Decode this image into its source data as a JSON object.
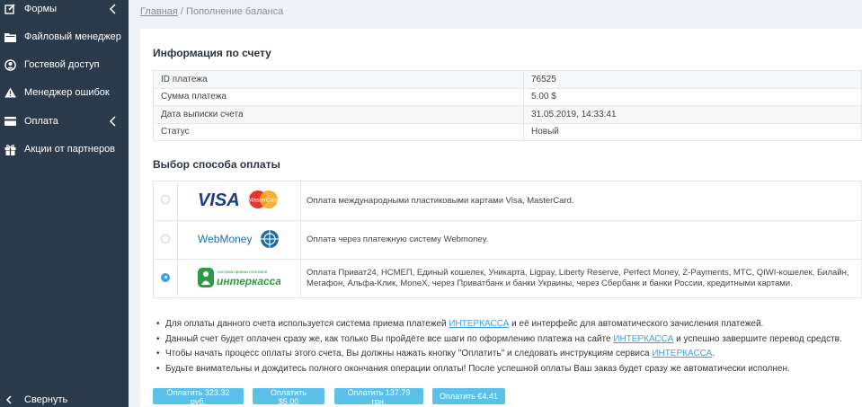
{
  "sidebar": {
    "items": [
      {
        "label": "Формы",
        "icon": "edit-icon",
        "has_chevron": true
      },
      {
        "label": "Файловый менеджер",
        "icon": "folder-icon",
        "has_chevron": false
      },
      {
        "label": "Гостевой доступ",
        "icon": "user-circle-icon",
        "has_chevron": false
      },
      {
        "label": "Менеджер ошибок",
        "icon": "warning-icon",
        "has_chevron": false
      },
      {
        "label": "Оплата",
        "icon": "credit-card-icon",
        "has_chevron": true
      },
      {
        "label": "Акции от партнеров",
        "icon": "gift-icon",
        "has_chevron": false
      }
    ],
    "collapse_label": "Свернуть"
  },
  "breadcrumb": {
    "home": "Главная",
    "separator": " / ",
    "current": "Пополнение баланса"
  },
  "info": {
    "title": "Информация по счету",
    "rows": [
      {
        "label": "ID платежа",
        "value": "76525"
      },
      {
        "label": "Сумма платежа",
        "value": "5.00 $"
      },
      {
        "label": "Дата выписки счета",
        "value": "31.05.2019, 14:33:41"
      },
      {
        "label": "Статус",
        "value": "Новый"
      }
    ]
  },
  "payment": {
    "title": "Выбор способа оплаты",
    "methods": [
      {
        "logo": "VISA",
        "logo_sub": "MasterCard",
        "description": "Оплата международными пластиковыми картами Visa, MasterCard.",
        "selected": false
      },
      {
        "logo": "WebMoney",
        "description": "Оплата через платежную систему Webmoney.",
        "selected": false
      },
      {
        "logo": "интеркасса",
        "logo_sub": "система приема платежей",
        "description": "Оплата Приват24, НСМЕП, Единый кошелек, Уникарта, Ligpay, Liberty Reserve, Perfect Money, Z-Payments, МТС, QIWI-кошелек, Билайн, Мегафон, Альфа-Клик, MoneX, через Приватбанк и банки Украины, через Сбербанк и банки России, кредитными картами.",
        "selected": true
      }
    ]
  },
  "notes": [
    {
      "before": "Для оплаты данного счета используется система приема платежей ",
      "link": "ИНТЕРКАССА",
      "after": " и её интерфейс для автоматического зачисления платежей."
    },
    {
      "before": "Данный счет будет оплачен сразу же, как только Вы пройдёте все шаги по оформлению платежа на сайте ",
      "link": "ИНТЕРКАССА",
      "after": " и успешно завершите перевод средств."
    },
    {
      "before": "Чтобы начать процесс оплаты этого счета, Вы должны нажать кнопку \"Оплатить\" и следовать инструкциям сервиса ",
      "link": "ИНТЕРКАССА",
      "after": "."
    },
    {
      "before": "Будьте внимательны и дождитесь полного окончания операции оплаты! После успешной оплаты Ваш заказ будет сразу же автоматически исполнен.",
      "link": "",
      "after": ""
    }
  ],
  "bullet": "•",
  "buttons": [
    {
      "label": "Оплатить 323.32 руб."
    },
    {
      "label": "Оплатить $5.00"
    },
    {
      "label": "Оплатить 137.79 грн."
    },
    {
      "label": "Оплатить €4.41"
    }
  ],
  "colors": {
    "sidebar_bg": "#2b3a4a",
    "accent": "#3aa3e3",
    "button_bg": "#5bc0ea",
    "page_bg": "#eef1f5"
  }
}
